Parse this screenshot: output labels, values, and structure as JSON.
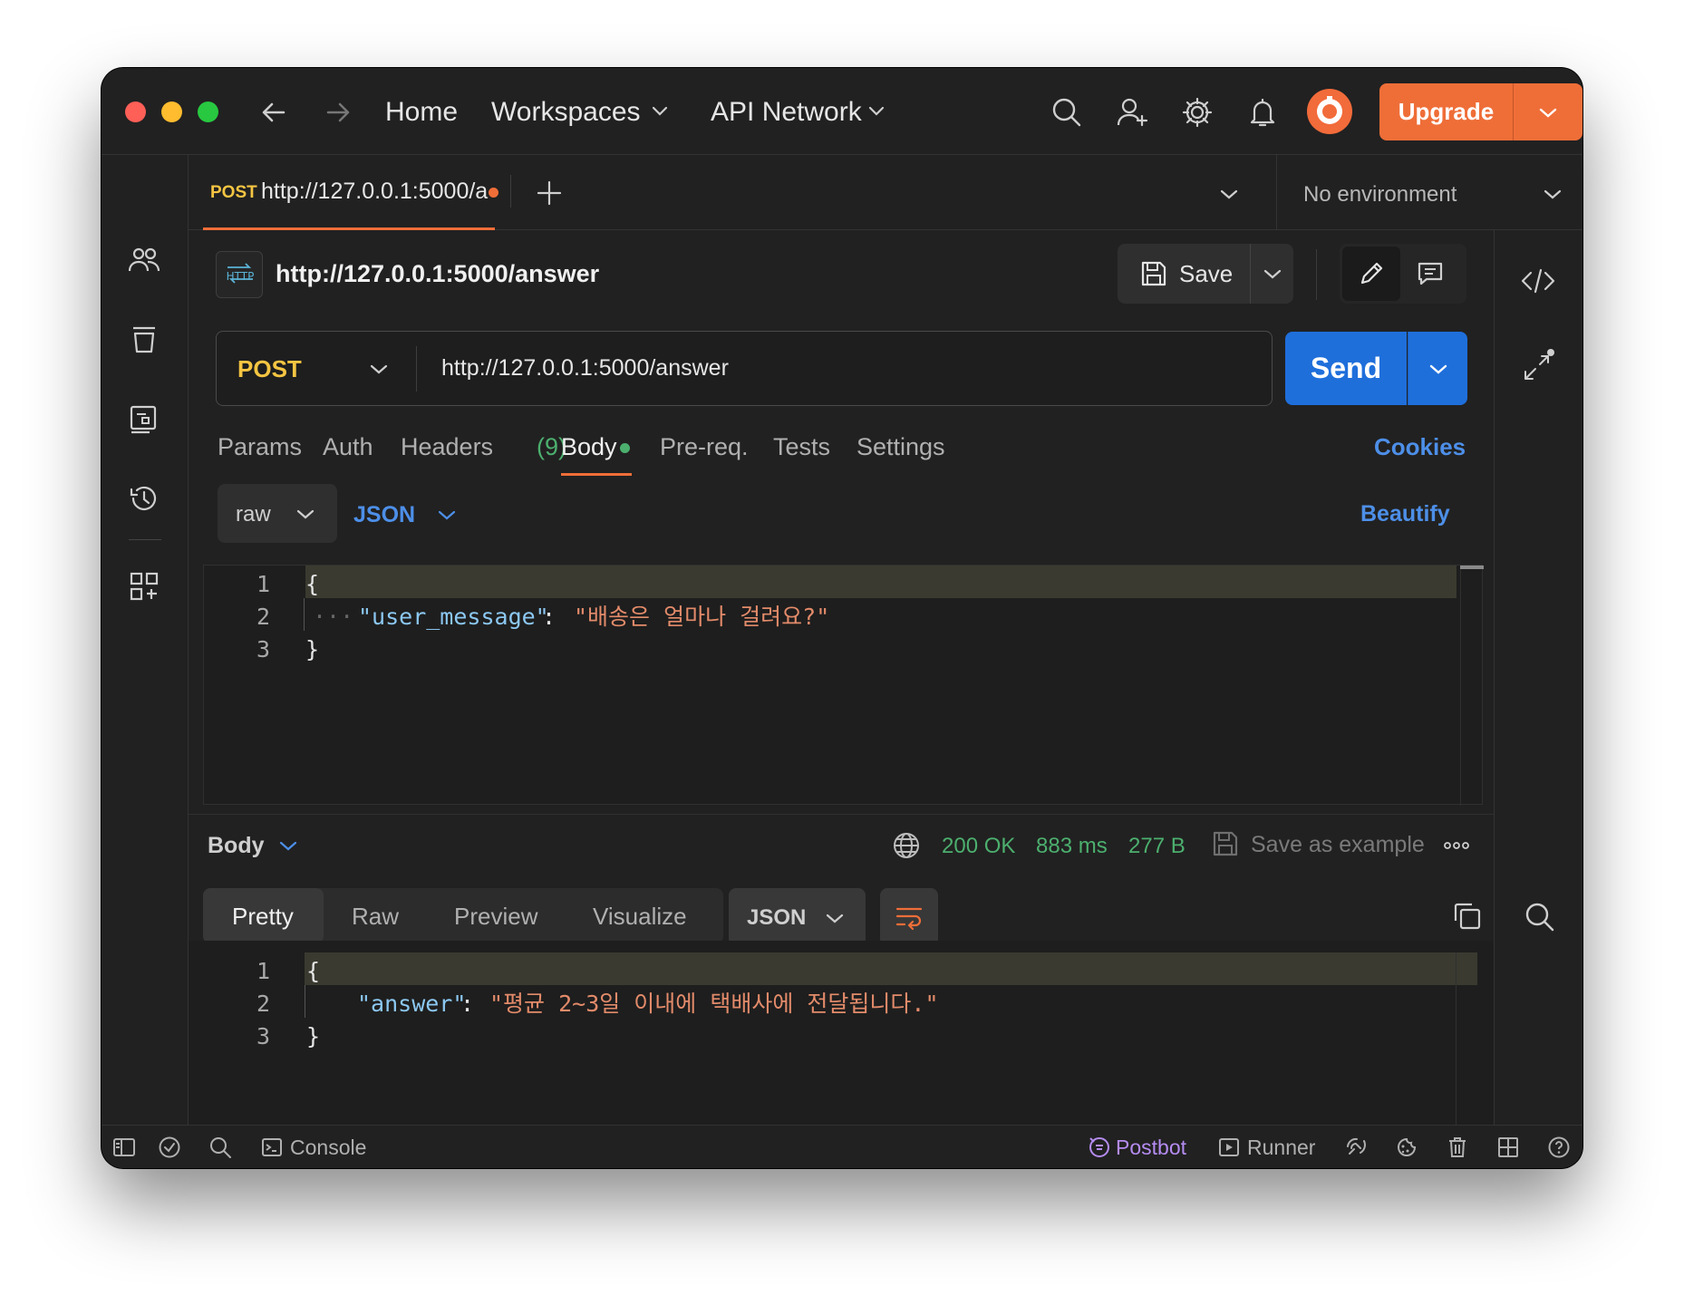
{
  "titlebar": {
    "nav": {
      "home": "Home",
      "workspaces": "Workspaces",
      "api_network": "API Network"
    },
    "upgrade_label": "Upgrade"
  },
  "tabs": [
    {
      "method": "POST",
      "title": "http://127.0.0.1:5000/a",
      "unsaved": true
    }
  ],
  "environment": {
    "selected": "No environment"
  },
  "request": {
    "name": "http://127.0.0.1:5000/answer",
    "save_label": "Save",
    "method": "POST",
    "url": "http://127.0.0.1:5000/answer",
    "send_label": "Send",
    "tabs": {
      "params": "Params",
      "auth": "Auth",
      "headers": "Headers",
      "headers_count": "(9)",
      "body": "Body",
      "prereq": "Pre-req.",
      "tests": "Tests",
      "settings": "Settings",
      "cookies": "Cookies"
    },
    "body_mode": "raw",
    "body_language": "JSON",
    "beautify_label": "Beautify",
    "code_lines": [
      {
        "num": "1",
        "text": "{"
      },
      {
        "num": "2",
        "key": "\"user_message\"",
        "sep": ": ",
        "value": "\"배송은 얼마나 걸려요?\""
      },
      {
        "num": "3",
        "text": "}"
      }
    ]
  },
  "response": {
    "section_label": "Body",
    "status": "200 OK",
    "time": "883 ms",
    "size": "277 B",
    "save_example_label": "Save as example",
    "view_tabs": [
      "Pretty",
      "Raw",
      "Preview",
      "Visualize"
    ],
    "active_view": "Pretty",
    "format": "JSON",
    "code_lines": [
      {
        "num": "1",
        "text": "{"
      },
      {
        "num": "2",
        "key": "\"answer\"",
        "sep": ": ",
        "value": "\"평균 2~3일 이내에 택배사에 전달됩니다.\""
      },
      {
        "num": "3",
        "text": "}"
      }
    ]
  },
  "statusbar": {
    "console": "Console",
    "postbot": "Postbot",
    "runner": "Runner"
  },
  "colors": {
    "accent_orange": "#ef6e38",
    "send_blue": "#1f6fdb",
    "method_post": "#f5c542",
    "success_green": "#4caf6e",
    "link_blue": "#4d8fe8",
    "json_key": "#8cc8f2",
    "json_string": "#e38b6a"
  }
}
